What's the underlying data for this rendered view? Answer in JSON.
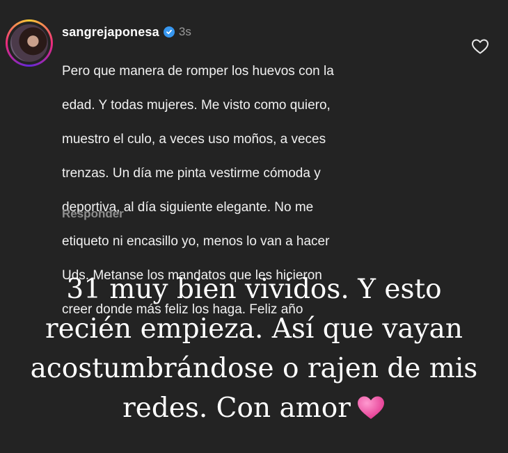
{
  "comment": {
    "username": "sangrejaponesa",
    "time": "3s",
    "text_lines": [
      "Pero que manera de romper los huevos con la",
      "edad. Y todas mujeres. Me visto como quiero,",
      "muestro el culo, a veces uso moños, a veces",
      "trenzas. Un día me pinta vestirme cómoda y",
      "deportiva, al día siguiente elegante. No me",
      "etiqueto ni encasillo yo, menos lo van a hacer",
      "Uds. Metanse los mandatos que les hicieron",
      "creer donde más feliz los haga. Feliz año"
    ],
    "reply_label": "Responder",
    "like_icon": "heart-outline-icon",
    "verified_icon": "verified-badge-icon"
  },
  "story": {
    "lines": [
      "31 muy bien vividos. Y esto",
      "recién empieza. Así que vayan",
      "acostumbrándose o rajen de mis",
      "redes. Con amor"
    ],
    "emoji": "pink-heart-icon",
    "emoji_color": "#f05aa6"
  },
  "colors": {
    "background": "#232323",
    "verified": "#3797f0"
  }
}
